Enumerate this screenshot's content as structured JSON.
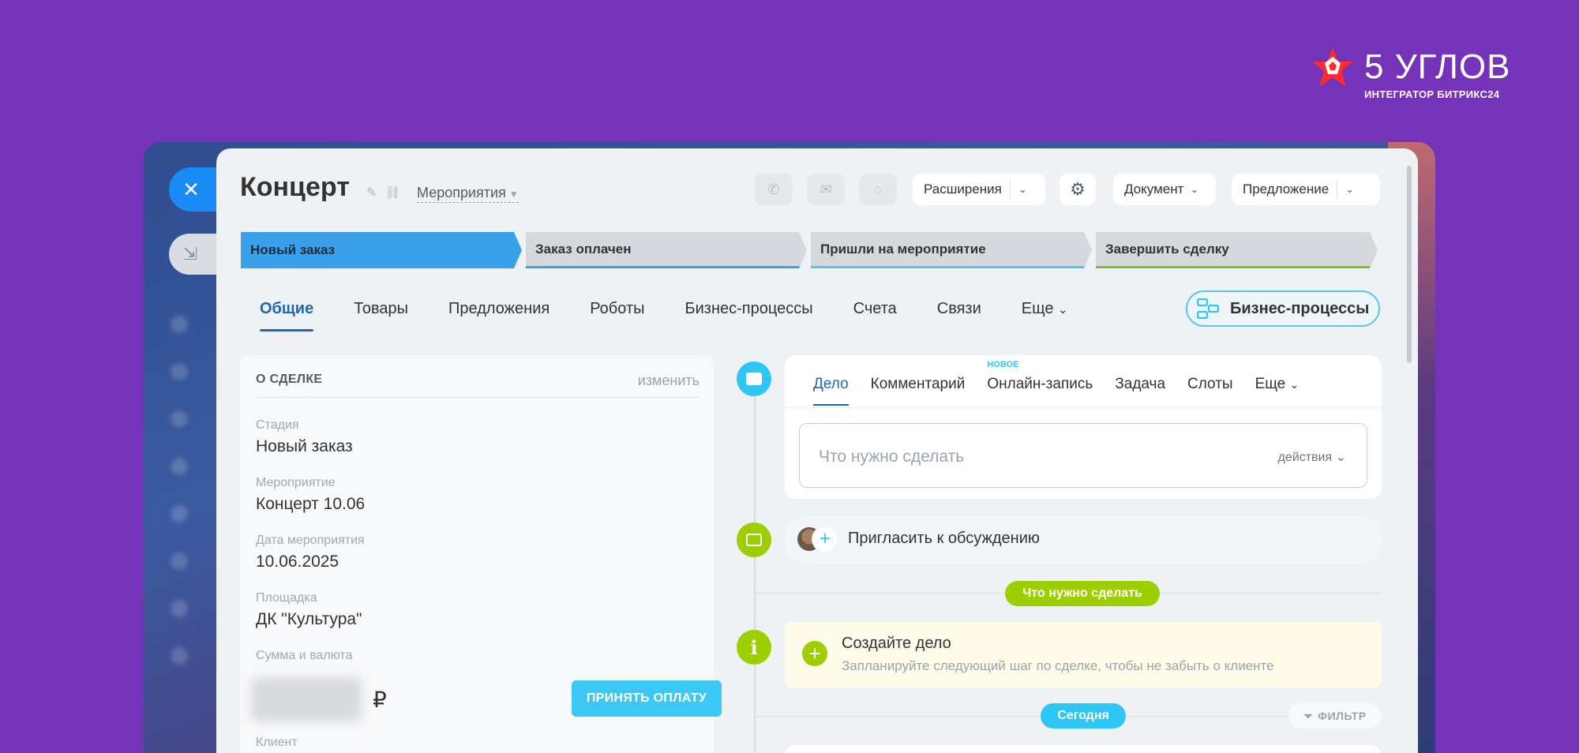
{
  "brand": {
    "name": "5 УГЛОВ",
    "subtitle": "ИНТЕГРАТОР БИТРИКС24"
  },
  "deal": {
    "title": "Концерт",
    "category": "Мероприятия"
  },
  "toolbar": {
    "icons": [
      "phone-icon",
      "mail-icon",
      "chat-icon"
    ],
    "extensions": "Расширения",
    "document": "Документ",
    "proposal": "Предложение"
  },
  "stages": [
    "Новый заказ",
    "Заказ оплачен",
    "Пришли на мероприятие",
    "Завершить сделку"
  ],
  "tabs": [
    "Общие",
    "Товары",
    "Предложения",
    "Роботы",
    "Бизнес-процессы",
    "Счета",
    "Связи",
    "Еще"
  ],
  "bp_button": "Бизнес-процессы",
  "about": {
    "header": "О СДЕЛКЕ",
    "edit": "изменить",
    "fields": [
      {
        "label": "Стадия",
        "value": "Новый заказ"
      },
      {
        "label": "Мероприятие",
        "value": "Концерт 10.06"
      },
      {
        "label": "Дата мероприятия",
        "value": "10.06.2025"
      },
      {
        "label": "Площадка",
        "value": "ДК \"Культура\""
      },
      {
        "label": "Сумма и валюта",
        "value": ""
      },
      {
        "label": "Клиент",
        "value": ""
      }
    ],
    "currency": "₽",
    "pay_button": "ПРИНЯТЬ ОПЛАТУ"
  },
  "editor": {
    "tabs": [
      "Дело",
      "Комментарий",
      "Онлайн-запись",
      "Задача",
      "Слоты",
      "Еще"
    ],
    "new_badge": "НОВОЕ",
    "placeholder": "Что нужно сделать",
    "actions": "действия"
  },
  "timeline": {
    "invite": "Пригласить к обсуждению",
    "todo_pill": "Что нужно сделать",
    "create_title": "Создайте дело",
    "create_hint": "Запланируйте следующий шаг по сделке, чтобы не забыть о клиенте",
    "today_pill": "Сегодня",
    "filter": "ФИЛЬТР"
  },
  "colors": {
    "background": "#7433b8",
    "accent": "#2067b0",
    "active_stage": "#3aa0ea",
    "green": "#9dcf00",
    "cyan": "#2fc6f6"
  }
}
